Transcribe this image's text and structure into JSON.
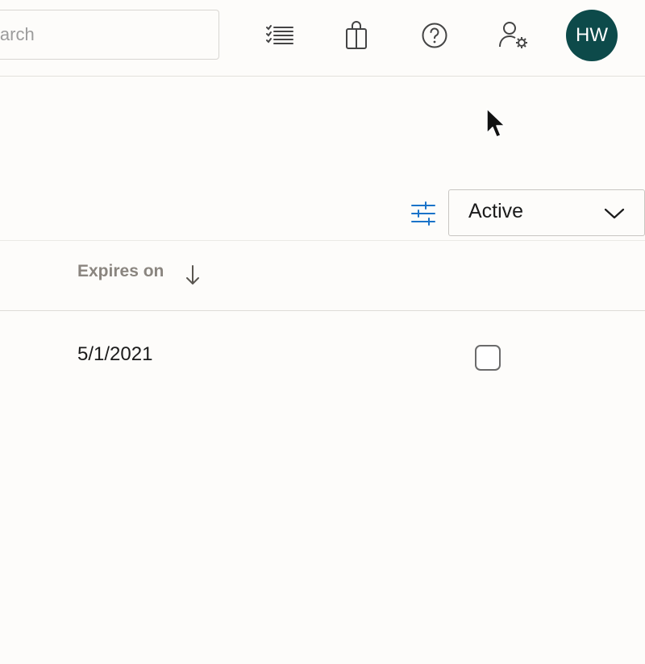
{
  "header": {
    "search": {
      "placeholder": "Search",
      "visible_fragment": "ch"
    },
    "icons": [
      "task-list-icon",
      "shopping-bag-icon",
      "help-icon",
      "user-settings-icon"
    ],
    "avatar": {
      "initials": "HW",
      "color": "#0d4a4a"
    }
  },
  "toolbar": {
    "filter_icon": "filter-sliders-icon",
    "status_dropdown": {
      "selected": "Active"
    }
  },
  "table": {
    "columns": [
      {
        "label": "Expires on",
        "sort": "descending"
      }
    ],
    "rows": [
      {
        "expires_on": "5/1/2021",
        "checked": false
      }
    ]
  },
  "colors": {
    "accent": "#1a73c9",
    "header_text": "#8a857f",
    "background": "#fdfcfa"
  }
}
